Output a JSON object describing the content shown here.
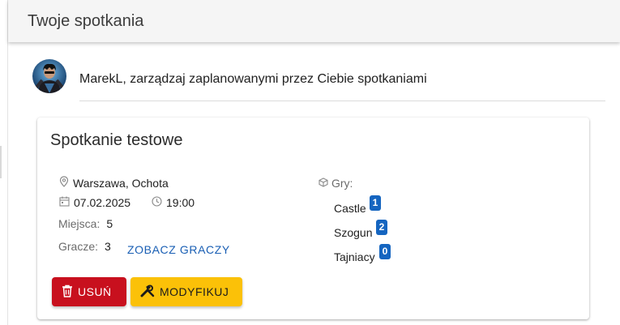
{
  "header": {
    "title": "Twoje spotkania"
  },
  "user": {
    "greeting": "MarekL, zarządzaj zaplanowanymi przez Ciebie spotkaniami"
  },
  "meeting": {
    "title": "Spotkanie testowe",
    "location": "Warszawa, Ochota",
    "date": "07.02.2025",
    "time": "19:00",
    "places_label": "Miejsca:",
    "places_value": "5",
    "players_label": "Gracze:",
    "players_value": "3",
    "see_players_label": "ZOBACZ GRACZY",
    "games_label": "Gry:",
    "games": [
      {
        "name": "Castle",
        "count": "1"
      },
      {
        "name": "Szogun",
        "count": "2"
      },
      {
        "name": "Tajniacy",
        "count": "0"
      }
    ],
    "delete_label": "USUŃ",
    "modify_label": "MODYFIKUJ"
  },
  "colors": {
    "accent": "#1565c0",
    "delete": "#c8101e",
    "modify": "#fbc108",
    "link": "#1a5fb4"
  },
  "icons": [
    "location-pin-icon",
    "calendar-icon",
    "clock-icon",
    "cube-icon",
    "trash-icon",
    "tools-icon"
  ]
}
